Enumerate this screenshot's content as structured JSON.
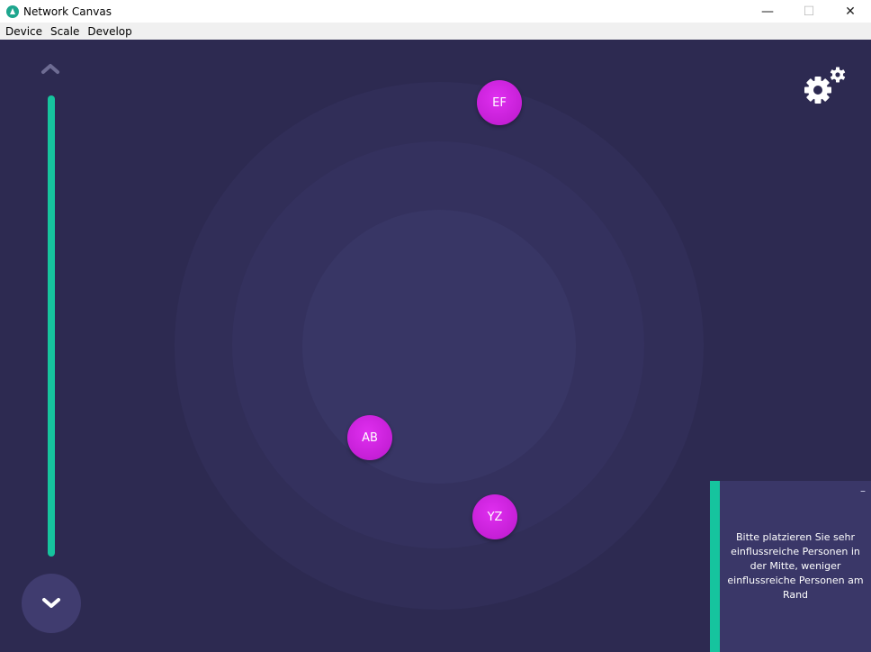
{
  "window": {
    "title": "Network Canvas",
    "minimize_glyph": "—",
    "maximize_glyph": "☐",
    "close_glyph": "✕"
  },
  "menu": {
    "items": [
      {
        "label": "Device"
      },
      {
        "label": "Scale"
      },
      {
        "label": "Develop"
      }
    ]
  },
  "canvas": {
    "nodes": [
      {
        "label": "EF"
      },
      {
        "label": "AB"
      },
      {
        "label": "YZ"
      }
    ],
    "controls": {
      "scroll_up_icon": "chevron-up-icon",
      "scroll_down_icon": "chevron-down-icon",
      "settings_icon": "gears-icon"
    }
  },
  "prompt": {
    "minimize_glyph": "–",
    "text": "Bitte platzieren Sie sehr einflussreiche Personen in der Mitte, weniger einflussreiche Personen am Rand"
  },
  "colors": {
    "background": "#2d2a51",
    "accent": "#16c49e",
    "node": "#c51fd6"
  }
}
